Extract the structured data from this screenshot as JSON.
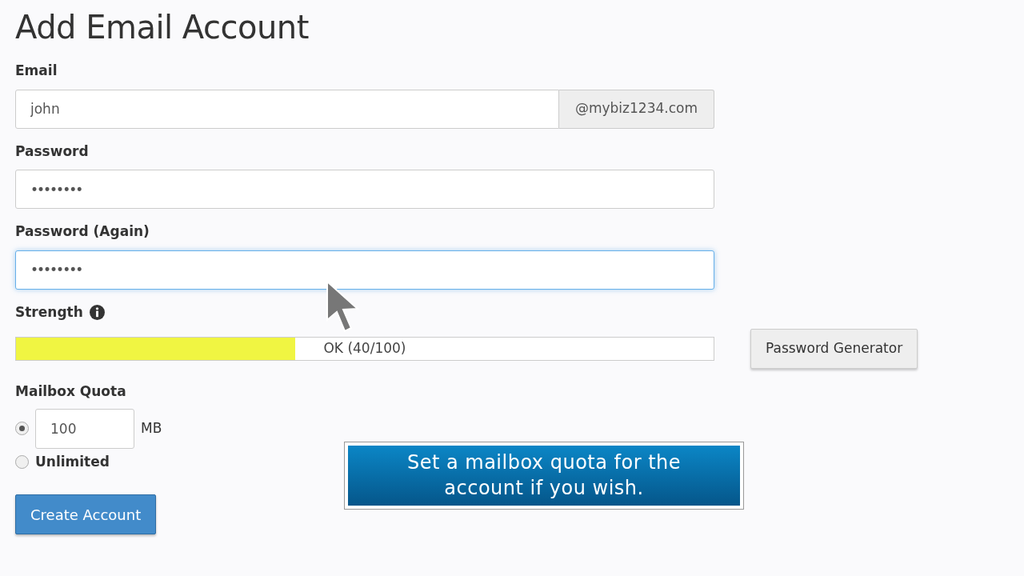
{
  "title": "Add Email Account",
  "email": {
    "label": "Email",
    "value": "john",
    "domain": "@mybiz1234.com"
  },
  "password": {
    "label": "Password",
    "value": "••••••••"
  },
  "password_again": {
    "label": "Password (Again)",
    "value": "••••••••",
    "focused": true
  },
  "strength": {
    "label": "Strength",
    "level": 0.4,
    "reading": "OK (40/100)",
    "color": "#f0f542"
  },
  "generator_button": "Password Generator",
  "quota": {
    "label": "Mailbox Quota",
    "options": [
      {
        "kind": "amount",
        "value": "100",
        "unit": "MB",
        "selected": true
      },
      {
        "kind": "unlimited",
        "label": "Unlimited",
        "selected": false
      }
    ]
  },
  "submit_button": "Create Account",
  "callout": "Set a mailbox quota for the account if you wish."
}
